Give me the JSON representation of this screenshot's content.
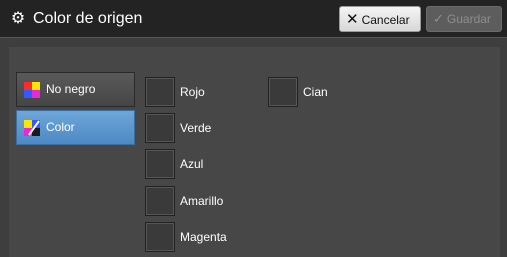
{
  "header": {
    "title": "Color de origen",
    "title_icon": "gear-icon",
    "cancel_label": "Cancelar",
    "save_label": "Guardar",
    "save_enabled": false
  },
  "modes": [
    {
      "label": "No negro",
      "selected": false
    },
    {
      "label": "Color",
      "selected": true
    }
  ],
  "colors": [
    {
      "label": "Rojo",
      "checked": false
    },
    {
      "label": "Verde",
      "checked": false
    },
    {
      "label": "Azul",
      "checked": false
    },
    {
      "label": "Amarillo",
      "checked": false
    },
    {
      "label": "Magenta",
      "checked": false
    },
    {
      "label": "Cian",
      "checked": false
    }
  ],
  "theme": {
    "selected_accent": "#5b97cf",
    "background": "#3e3e3e",
    "titlebar": "#232323"
  }
}
